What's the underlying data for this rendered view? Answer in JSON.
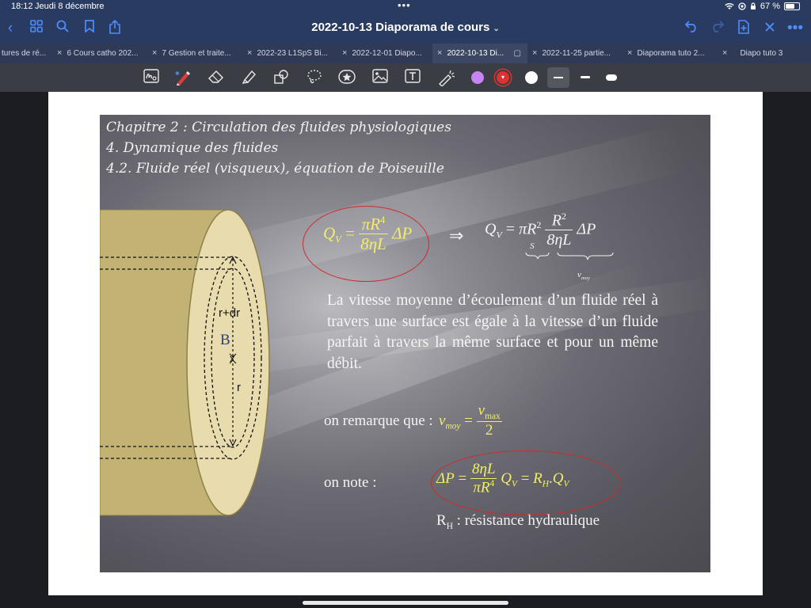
{
  "status": {
    "time": "18:12",
    "date": "Jeudi 8 décembre",
    "battery": "67 %",
    "battery_level": 0.67
  },
  "titlebar": {
    "title": "2022-10-13 Diaporama de cours"
  },
  "tabs": [
    {
      "label": "tures de ré..."
    },
    {
      "label": "6 Cours catho 202..."
    },
    {
      "label": "7 Gestion et traite..."
    },
    {
      "label": "2022-23 L1SpS Bi..."
    },
    {
      "label": "2022-12-01 Diapo..."
    },
    {
      "label": "2022-10-13 Di..."
    },
    {
      "label": "2022-11-25 partie..."
    },
    {
      "label": "Diaporama tuto 2..."
    },
    {
      "label": "Diapo tuto 3"
    }
  ],
  "colors": {
    "lavender": "#c685f2",
    "red": "#e03131",
    "white": "#ffffff",
    "formula_yellow": "#f3ee67",
    "circle_red": "#d22a2a",
    "cylinder": "#c9b977"
  },
  "slide": {
    "heading1": "Chapitre 2 : Circulation des fluides physiologiques",
    "heading2": "4. Dynamique des fluides",
    "heading3": "4.2. Fluide réel (visqueux), équation de Poiseuille",
    "label_rdr": "r+dr",
    "label_b": "B",
    "label_x": "x",
    "label_r": "r",
    "eq1": {
      "lhs": "Q",
      "lhs_sub": "V",
      "eq": "=",
      "num": "πR",
      "num_sup": "4",
      "den": "8ηL",
      "tail": "ΔP"
    },
    "implies": "⇒",
    "eq2": {
      "lhs": "Q",
      "lhs_sub": "V",
      "eq": "=",
      "pir2": "πR",
      "pir2_sup": "2",
      "s": "S",
      "num": "R",
      "num_sup": "2",
      "den": "8ηL",
      "tail": "ΔP",
      "vmoy": "v",
      "vmoy_sub": "moy"
    },
    "paragraph": "La vitesse moyenne d’écoulement d’un fluide réel à travers une surface est égale à la vitesse d’un fluide parfait à travers la même surface et pour un même débit.",
    "remark_label": "on remarque que :",
    "remark": {
      "lhs": "v",
      "lhs_sub": "moy",
      "eq": "=",
      "num": "v",
      "num_sub": "max",
      "den": "2"
    },
    "note_label": "on note :",
    "note": {
      "lhs": "ΔP",
      "eq": "=",
      "num": "8ηL",
      "den": "πR",
      "den_sup": "4",
      "q": "Q",
      "q_sub": "V",
      "eq2": "=",
      "r": "R",
      "r_sub": "H",
      "dot": ".",
      "q2": "Q",
      "q2_sub": "V"
    },
    "rh_label": "R",
    "rh_sub": "H",
    "rh_text": " : résistance hydraulique"
  }
}
